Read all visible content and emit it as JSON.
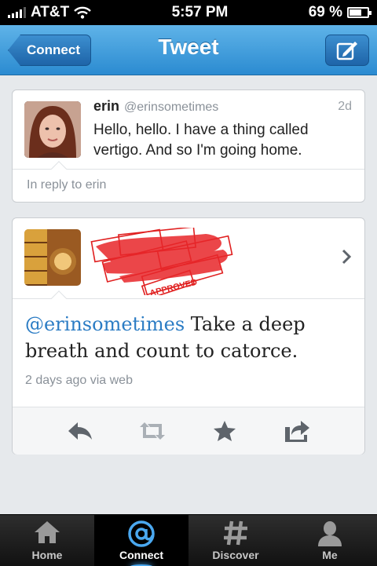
{
  "status_bar": {
    "carrier": "AT&T",
    "time": "5:57 PM",
    "battery": "69 %",
    "battery_level": 0.69
  },
  "nav": {
    "back_label": "Connect",
    "title": "Tweet",
    "compose_icon": "compose-icon"
  },
  "parent_tweet": {
    "name": "erin",
    "handle": "@erinsometimes",
    "time": "2d",
    "text": "Hello, hello. I have a thing called vertigo. And so I'm going home.",
    "reply_context": "In reply to erin"
  },
  "main_tweet": {
    "stamp_text": "APPROVED",
    "mention": "@erinsometimes",
    "body": " Take a deep breath and count to catorce.",
    "meta": "2 days ago via web"
  },
  "actions": [
    "reply-icon",
    "retweet-icon",
    "favorite-icon",
    "share-icon"
  ],
  "tabs": [
    {
      "label": "Home",
      "icon": "home-icon",
      "active": false
    },
    {
      "label": "Connect",
      "icon": "at-icon",
      "active": true
    },
    {
      "label": "Discover",
      "icon": "hash-icon",
      "active": false
    },
    {
      "label": "Me",
      "icon": "person-icon",
      "active": false
    }
  ],
  "colors": {
    "nav_blue": "#2b8bd1",
    "mention_blue": "#2b7cc4",
    "stamp_red": "#e02020"
  }
}
